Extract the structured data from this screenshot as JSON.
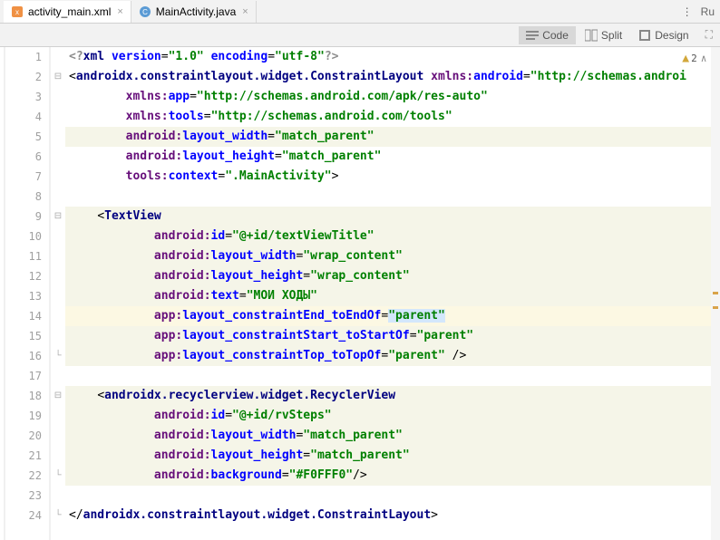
{
  "tabs": [
    {
      "label": "activity_main.xml",
      "active": true
    },
    {
      "label": "MainActivity.java",
      "active": false
    }
  ],
  "topRight": {
    "runHint": "Ru"
  },
  "viewModes": {
    "code": "Code",
    "split": "Split",
    "design": "Design"
  },
  "warnCount": "2",
  "lines": {
    "n1": "1",
    "n2": "2",
    "n3": "3",
    "n4": "4",
    "n5": "5",
    "n6": "6",
    "n7": "7",
    "n8": "8",
    "n9": "9",
    "n10": "10",
    "n11": "11",
    "n12": "12",
    "n13": "13",
    "n14": "14",
    "n15": "15",
    "n16": "16",
    "n17": "17",
    "n18": "18",
    "n19": "19",
    "n20": "20",
    "n21": "21",
    "n22": "22",
    "n23": "23",
    "n24": "24"
  },
  "code": {
    "l1": {
      "prolog_open": "<?",
      "prolog_xml": "xml ",
      "attr_ver": "version",
      "eq": "=",
      "val_ver": "\"1.0\"",
      "sp": " ",
      "attr_enc": "encoding",
      "val_enc": "\"utf-8\"",
      "prolog_close": "?>"
    },
    "l2": {
      "lt": "<",
      "tag": "androidx.constraintlayout.widget.ConstraintLayout",
      "sp": " ",
      "ns": "xmlns:",
      "attr": "android",
      "eq": "=",
      "val": "\"http://schemas.androi"
    },
    "l3": {
      "indent": "        ",
      "ns": "xmlns:",
      "attr": "app",
      "eq": "=",
      "val": "\"http://schemas.android.com/apk/res-auto\""
    },
    "l4": {
      "indent": "        ",
      "ns": "xmlns:",
      "attr": "tools",
      "eq": "=",
      "val": "\"http://schemas.android.com/tools\""
    },
    "l5": {
      "indent": "        ",
      "ns": "android:",
      "attr": "layout_width",
      "eq": "=",
      "val": "\"match_parent\""
    },
    "l6": {
      "indent": "        ",
      "ns": "android:",
      "attr": "layout_height",
      "eq": "=",
      "val": "\"match_parent\""
    },
    "l7": {
      "indent": "        ",
      "ns": "tools:",
      "attr": "context",
      "eq": "=",
      "val": "\".MainActivity\"",
      "gt": ">"
    },
    "l9": {
      "indent": "    ",
      "lt": "<",
      "tag": "TextView"
    },
    "l10": {
      "indent": "            ",
      "ns": "android:",
      "attr": "id",
      "eq": "=",
      "val": "\"@+id/textViewTitle\""
    },
    "l11": {
      "indent": "            ",
      "ns": "android:",
      "attr": "layout_width",
      "eq": "=",
      "val": "\"wrap_content\""
    },
    "l12": {
      "indent": "            ",
      "ns": "android:",
      "attr": "layout_height",
      "eq": "=",
      "val": "\"wrap_content\""
    },
    "l13": {
      "indent": "            ",
      "ns": "android:",
      "attr": "text",
      "eq": "=",
      "val": "\"МОИ ХОДЫ\""
    },
    "l14": {
      "indent": "            ",
      "ns": "app:",
      "attr": "layout_constraintEnd_toEndOf",
      "eq": "=",
      "q1": "\"",
      "selval": "parent",
      "q2": "\""
    },
    "l15": {
      "indent": "            ",
      "ns": "app:",
      "attr": "layout_constraintStart_toStartOf",
      "eq": "=",
      "val": "\"parent\""
    },
    "l16": {
      "indent": "            ",
      "ns": "app:",
      "attr": "layout_constraintTop_toTopOf",
      "eq": "=",
      "val": "\"parent\"",
      "close": " />"
    },
    "l18": {
      "indent": "    ",
      "lt": "<",
      "tag": "androidx.recyclerview.widget.RecyclerView"
    },
    "l19": {
      "indent": "            ",
      "ns": "android:",
      "attr": "id",
      "eq": "=",
      "val": "\"@+id/rvSteps\""
    },
    "l20": {
      "indent": "            ",
      "ns": "android:",
      "attr": "layout_width",
      "eq": "=",
      "val": "\"match_parent\""
    },
    "l21": {
      "indent": "            ",
      "ns": "android:",
      "attr": "layout_height",
      "eq": "=",
      "val": "\"match_parent\""
    },
    "l22": {
      "indent": "            ",
      "ns": "android:",
      "attr": "background",
      "eq": "=",
      "val": "\"#F0FFF0\"",
      "close": "/>"
    },
    "l24": {
      "lt": "</",
      "tag": "androidx.constraintlayout.widget.ConstraintLayout",
      "gt": ">"
    }
  }
}
